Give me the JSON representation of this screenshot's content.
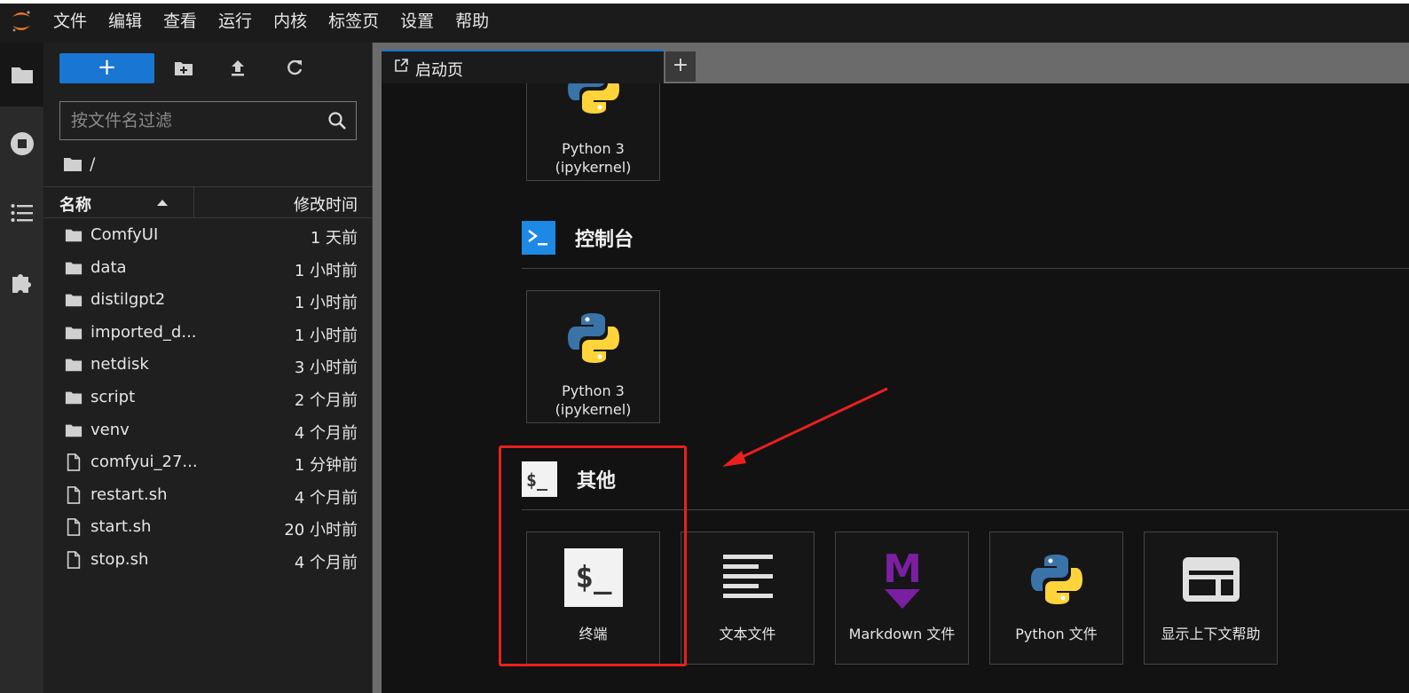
{
  "menubar": {
    "items": [
      "文件",
      "编辑",
      "查看",
      "运行",
      "内核",
      "标签页",
      "设置",
      "帮助"
    ]
  },
  "activity": {
    "items": [
      "folder-icon",
      "running-icon",
      "toc-icon",
      "extension-icon"
    ]
  },
  "filebrowser": {
    "new_label": "+",
    "filter_placeholder": "按文件名过滤",
    "breadcrumb": "/",
    "col_name": "名称",
    "col_modified": "修改时间",
    "files": [
      {
        "name": "ComfyUI",
        "time": "1 天前",
        "type": "folder"
      },
      {
        "name": "data",
        "time": "1 小时前",
        "type": "folder"
      },
      {
        "name": "distilgpt2",
        "time": "1 小时前",
        "type": "folder"
      },
      {
        "name": "imported_d...",
        "time": "1 小时前",
        "type": "folder"
      },
      {
        "name": "netdisk",
        "time": "3 小时前",
        "type": "folder"
      },
      {
        "name": "script",
        "time": "2 个月前",
        "type": "folder"
      },
      {
        "name": "venv",
        "time": "4 个月前",
        "type": "folder"
      },
      {
        "name": "comfyui_27...",
        "time": "1 分钟前",
        "type": "file"
      },
      {
        "name": "restart.sh",
        "time": "4 个月前",
        "type": "file"
      },
      {
        "name": "start.sh",
        "time": "20 小时前",
        "type": "file"
      },
      {
        "name": "stop.sh",
        "time": "4 个月前",
        "type": "file"
      }
    ]
  },
  "tabs": {
    "launcher_label": "启动页",
    "add_label": "+"
  },
  "launcher": {
    "notebook_card": {
      "line1": "Python 3",
      "line2": "(ipykernel)"
    },
    "console_title": "控制台",
    "console_card": {
      "line1": "Python 3",
      "line2": "(ipykernel)"
    },
    "other_title": "其他",
    "other_cards": [
      "终端",
      "文本文件",
      "Markdown 文件",
      "Python 文件",
      "显示上下文帮助"
    ],
    "terminal_glyph": "$_",
    "markdown_glyph": "M"
  },
  "colors": {
    "accent": "#1976d2",
    "annotation": "#e8201f",
    "markdown": "#7b1fa2",
    "python_blue": "#3a73a8",
    "python_yellow": "#ffd43b"
  }
}
